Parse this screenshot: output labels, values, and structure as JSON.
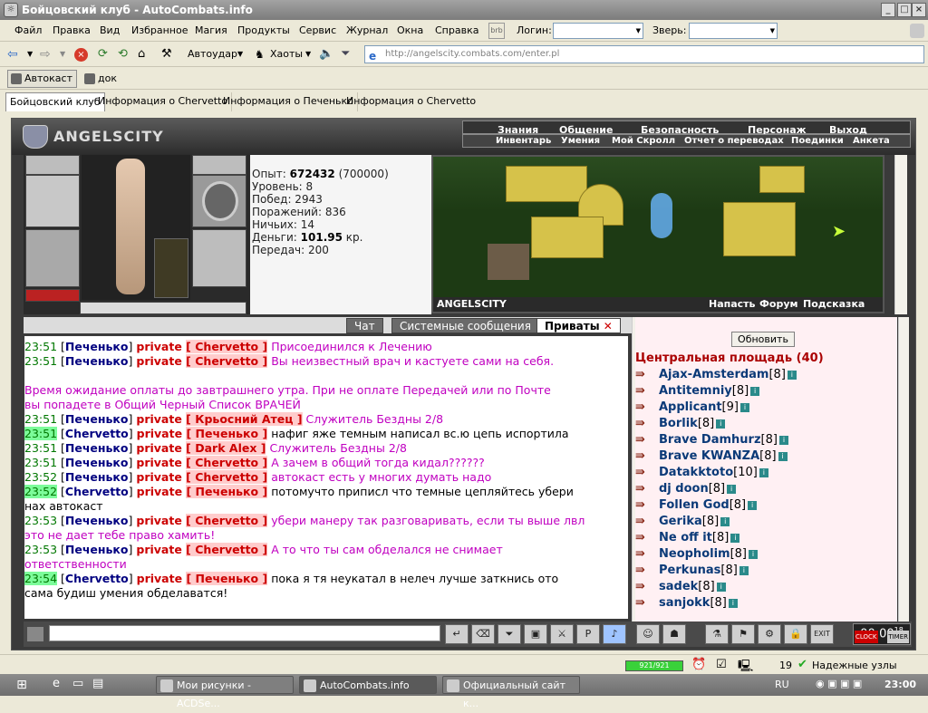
{
  "window": {
    "title": "Бойцовский клуб - AutoCombats.info"
  },
  "menu": [
    "Файл",
    "Правка",
    "Вид",
    "Избранное",
    "Магия",
    "Продукты",
    "Сервис",
    "Журнал",
    "Окна",
    "Справка"
  ],
  "menu_right": {
    "login_label": "Логин:",
    "beast_label": "Зверь:",
    "bb_label": "brb"
  },
  "toolbar": {
    "autoudar": "Автоудар",
    "haoty": "Хаоты",
    "address": "http://angelscity.combats.com/enter.pl"
  },
  "toolbar2": {
    "autocast": "Автокаст",
    "dok": "док"
  },
  "tabs": [
    "Бойцовский клуб",
    "Информация о Chervetto",
    "Информация о Печенько",
    "Информация о Chervetto"
  ],
  "game": {
    "logo": "ANGELSCITY",
    "nav_top": [
      "Знания",
      "Общение",
      "Безопасность",
      "Персонаж",
      "Выход"
    ],
    "nav_bottom": [
      "Инвентарь",
      "Умения",
      "Мой Скролл",
      "Отчет о переводах",
      "Поединки",
      "Анкета"
    ],
    "scene_footer_logo": "ANGELSCITY",
    "scene_links": [
      "Напасть",
      "Форум",
      "Подсказка"
    ]
  },
  "stats": {
    "exp_label": "Опыт:",
    "exp_value": "672432",
    "exp_next": "(700000)",
    "level": "Уровень: 8",
    "wins": "Побед: 2943",
    "losses": "Поражений: 836",
    "draws": "Ничьих: 14",
    "money_label": "Деньги:",
    "money_value": "101.95",
    "money_unit": "кр.",
    "transfers": "Передач: 200"
  },
  "chat_tabs": [
    "Чат",
    "Системные сообщения",
    "Приваты"
  ],
  "chat": [
    {
      "time": "23:51",
      "nick": "Печенько",
      "to": "Chervetto",
      "msg": "Присоединился к Лечению",
      "color": "m",
      "hl": false
    },
    {
      "time": "23:51",
      "nick": "Печенько",
      "to": "Chervetto",
      "msg": "Вы неизвестный врач и кастуете сами на себя.",
      "color": "m",
      "hl": false
    },
    {
      "time": "",
      "nick": "",
      "to": "",
      "msg": "Время ожидание оплаты до завтрашнего утра. При не оплате Передачей или по Почте",
      "color": "m",
      "hl": false
    },
    {
      "time": "",
      "nick": "",
      "to": "",
      "msg": "вы попадете в Общий Черный Список ВРАЧЕЙ",
      "color": "m",
      "hl": false
    },
    {
      "time": "23:51",
      "nick": "Печенько",
      "to": "Крьосний Атец",
      "msg": "Служитель Бездны 2/8",
      "color": "m",
      "hl": false
    },
    {
      "time": "23:51",
      "nick": "Chervetto",
      "to": "Печенько",
      "msg": "нафиг яже темным написал вс.ю цепь испортила",
      "color": "k",
      "hl": true
    },
    {
      "time": "23:51",
      "nick": "Печенько",
      "to": "Dark Alex",
      "msg": "Служитель Бездны 2/8",
      "color": "m",
      "hl": false
    },
    {
      "time": "23:51",
      "nick": "Печенько",
      "to": "Chervetto",
      "msg": "А зачем в общий тогда кидал??????",
      "color": "m",
      "hl": false
    },
    {
      "time": "23:52",
      "nick": "Печенько",
      "to": "Chervetto",
      "msg": "автокаст есть у многих думать надо",
      "color": "m",
      "hl": false
    },
    {
      "time": "23:52",
      "nick": "Chervetto",
      "to": "Печенько",
      "msg": "потомучто приписл что темные цепляйтесь убери",
      "color": "k",
      "hl": true
    },
    {
      "time": "",
      "nick": "",
      "to": "",
      "msg": "нах автокаст",
      "color": "k",
      "hl": false
    },
    {
      "time": "23:53",
      "nick": "Печенько",
      "to": "Chervetto",
      "msg": "убери манеру так разговаривать, если ты выше лвл",
      "color": "m",
      "hl": false
    },
    {
      "time": "",
      "nick": "",
      "to": "",
      "msg": "это не дает тебе право хамить!",
      "color": "m",
      "hl": false
    },
    {
      "time": "23:53",
      "nick": "Печенько",
      "to": "Chervetto",
      "msg": "А то что ты сам обделался не снимает",
      "color": "m",
      "hl": false
    },
    {
      "time": "",
      "nick": "",
      "to": "",
      "msg": "ответственности",
      "color": "m",
      "hl": false
    },
    {
      "time": "23:54",
      "nick": "Chervetto",
      "to": "Печенько",
      "msg": "пока я тя неукатал в нелеч лучше заткнись ото",
      "color": "k",
      "hl": true
    },
    {
      "time": "",
      "nick": "",
      "to": "",
      "msg": "сама будиш умения обделаватся!",
      "color": "k",
      "hl": false
    }
  ],
  "chat_private_label": "private",
  "users": {
    "refresh": "Обновить",
    "title": "Центральная площадь (40)",
    "list": [
      {
        "name": "Ajax-Amsterdam",
        "lvl": "[8]"
      },
      {
        "name": "Antitemniy",
        "lvl": "[8]"
      },
      {
        "name": "Applicant",
        "lvl": "[9]"
      },
      {
        "name": "Borlik",
        "lvl": "[8]"
      },
      {
        "name": "Brave Damhurz",
        "lvl": "[8]"
      },
      {
        "name": "Brave KWANZA",
        "lvl": "[8]"
      },
      {
        "name": "Datakktoto",
        "lvl": "[10]"
      },
      {
        "name": "dj doon",
        "lvl": "[8]"
      },
      {
        "name": "Follen God",
        "lvl": "[8]"
      },
      {
        "name": "Gerika",
        "lvl": "[8]"
      },
      {
        "name": "Ne off it",
        "lvl": "[8]"
      },
      {
        "name": "Neopholim",
        "lvl": "[8]"
      },
      {
        "name": "Perkunas",
        "lvl": "[8]"
      },
      {
        "name": "sadek",
        "lvl": "[8]"
      },
      {
        "name": "sanjokk",
        "lvl": "[8]"
      }
    ]
  },
  "clock": {
    "time": "00:00",
    "sec": "18",
    "label_clock": "CLOCK",
    "label_timer": "TIMER"
  },
  "status": {
    "hp": "921/921",
    "count": "19",
    "nodes": "Надежные узлы"
  },
  "taskbar": {
    "tasks": [
      "Мои рисунки - ACDSe...",
      "AutoCombats.info",
      "Официальный сайт к..."
    ],
    "lang": "RU",
    "time": "23:00"
  }
}
